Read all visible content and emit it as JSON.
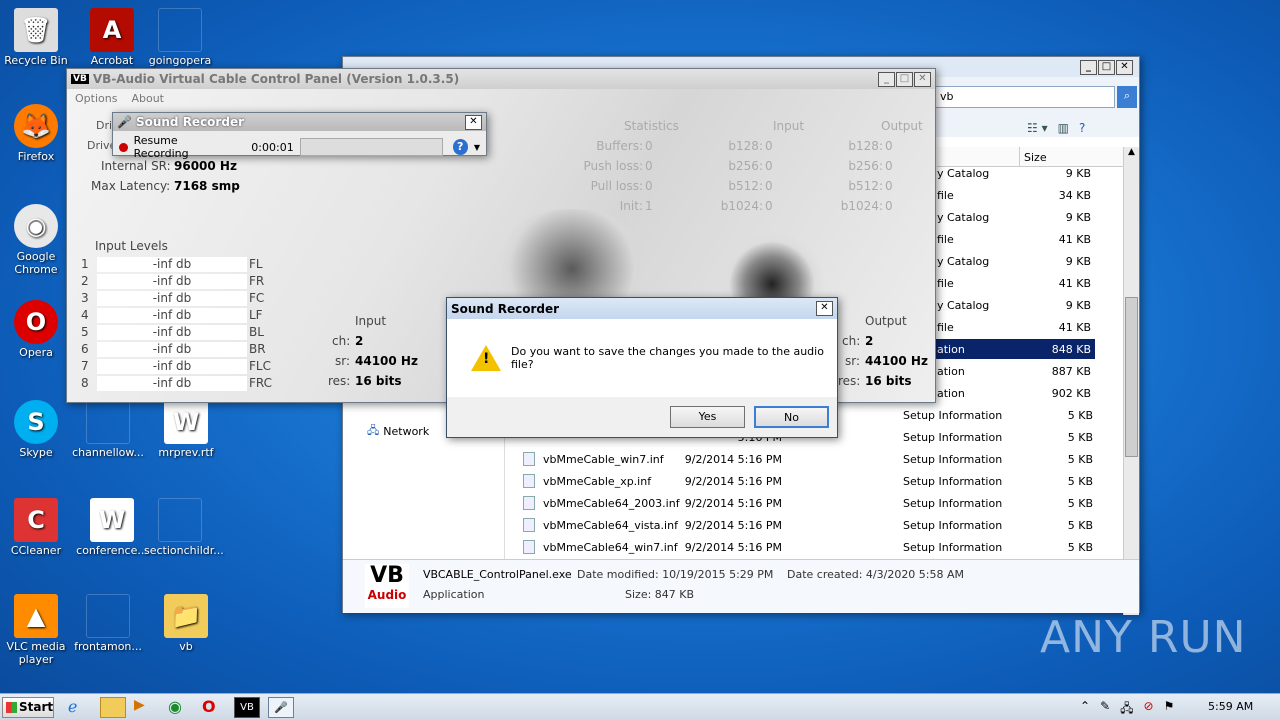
{
  "desktop": {
    "icons": [
      {
        "label": "Recycle Bin",
        "glyph": "🗑"
      },
      {
        "label": "Acrobat",
        "glyph": "A"
      },
      {
        "label": "goingopera",
        "glyph": ""
      },
      {
        "label": "Firefox",
        "glyph": "🦊"
      },
      {
        "label": "Google Chrome",
        "glyph": "◉"
      },
      {
        "label": "Opera",
        "glyph": "O"
      },
      {
        "label": "Skype",
        "glyph": "S"
      },
      {
        "label": "channellow...",
        "glyph": ""
      },
      {
        "label": "mrprev.rtf",
        "glyph": "W"
      },
      {
        "label": "CCleaner",
        "glyph": "C"
      },
      {
        "label": "conference...",
        "glyph": "W"
      },
      {
        "label": "sectionchildr...",
        "glyph": ""
      },
      {
        "label": "VLC media player",
        "glyph": "▲"
      },
      {
        "label": "frontamon...",
        "glyph": ""
      },
      {
        "label": "vb",
        "glyph": "📁"
      }
    ]
  },
  "vb_panel": {
    "title": "VB-Audio Virtual Cable Control Panel (Version 1.0.3.5)",
    "menu": [
      "Options",
      "About"
    ],
    "labels": {
      "internal_sr": "Internal SR:",
      "max_latency": "Max Latency:",
      "driver1": "Dri",
      "driver2": "Drive"
    },
    "values": {
      "internal_sr": "96000 Hz",
      "max_latency": "7168 smp"
    },
    "input_levels_title": "Input Levels",
    "levels": [
      {
        "n": "1",
        "val": "-inf db",
        "ch": "FL"
      },
      {
        "n": "2",
        "val": "-inf db",
        "ch": "FR"
      },
      {
        "n": "3",
        "val": "-inf db",
        "ch": "FC"
      },
      {
        "n": "4",
        "val": "-inf db",
        "ch": "LF"
      },
      {
        "n": "5",
        "val": "-inf db",
        "ch": "BL"
      },
      {
        "n": "6",
        "val": "-inf db",
        "ch": "BR"
      },
      {
        "n": "7",
        "val": "-inf db",
        "ch": "FLC"
      },
      {
        "n": "8",
        "val": "-inf db",
        "ch": "FRC"
      }
    ],
    "stats": {
      "headers": [
        "Statistics",
        "Input",
        "Output"
      ],
      "rows": [
        {
          "a": "Buffers:",
          "av": "0",
          "b": "b128:",
          "bv": "0",
          "c": "b128:",
          "cv": "0"
        },
        {
          "a": "Push loss:",
          "av": "0",
          "b": "b256:",
          "bv": "0",
          "c": "b256:",
          "cv": "0"
        },
        {
          "a": "Pull loss:",
          "av": "0",
          "b": "b512:",
          "bv": "0",
          "c": "b512:",
          "cv": "0"
        },
        {
          "a": "Init:",
          "av": "1",
          "b": "b1024:",
          "bv": "0",
          "c": "b1024:",
          "cv": "0"
        }
      ]
    },
    "input": {
      "title": "Input",
      "ch_label": "ch:",
      "ch": "2",
      "sr_label": "sr:",
      "sr": "44100 Hz",
      "res_label": "res:",
      "res": "16 bits"
    },
    "output": {
      "title": "Output",
      "ch_label": "ch:",
      "ch": "2",
      "sr_label": "sr:",
      "sr": "44100 Hz",
      "res_label": "res:",
      "res": "16 bits"
    }
  },
  "recorder": {
    "title": "Sound Recorder",
    "resume": "Resume Recording",
    "time": "0:00:01",
    "help": "?"
  },
  "dialog": {
    "title": "Sound Recorder",
    "message": "Do you want to save the changes you made to the audio file?",
    "yes": "Yes",
    "no": "No"
  },
  "explorer": {
    "search_value": "vb",
    "size_header": "Size",
    "network": "Network",
    "partial_rows": [
      {
        "type": "y Catalog",
        "size": "9 KB"
      },
      {
        "type": "file",
        "size": "34 KB"
      },
      {
        "type": "y Catalog",
        "size": "9 KB"
      },
      {
        "type": "file",
        "size": "41 KB"
      },
      {
        "type": "y Catalog",
        "size": "9 KB"
      },
      {
        "type": "file",
        "size": "41 KB"
      },
      {
        "type": "y Catalog",
        "size": "9 KB"
      },
      {
        "type": "file",
        "size": "41 KB"
      },
      {
        "type": "ation",
        "size": "848 KB"
      },
      {
        "type": "ation",
        "size": "887 KB"
      },
      {
        "type": "ation",
        "size": "902 KB"
      }
    ],
    "files": [
      {
        "name": "",
        "date": "5:16 PM",
        "type": "Setup Information",
        "size": "5 KB"
      },
      {
        "name": "",
        "date": "5:16 PM",
        "type": "Setup Information",
        "size": "5 KB"
      },
      {
        "name": "vbMmeCable_win7.inf",
        "date": "9/2/2014 5:16 PM",
        "type": "Setup Information",
        "size": "5 KB"
      },
      {
        "name": "vbMmeCable_xp.inf",
        "date": "9/2/2014 5:16 PM",
        "type": "Setup Information",
        "size": "5 KB"
      },
      {
        "name": "vbMmeCable64_2003.inf",
        "date": "9/2/2014 5:16 PM",
        "type": "Setup Information",
        "size": "5 KB"
      },
      {
        "name": "vbMmeCable64_vista.inf",
        "date": "9/2/2014 5:16 PM",
        "type": "Setup Information",
        "size": "5 KB"
      },
      {
        "name": "vbMmeCable64_win7.inf",
        "date": "9/2/2014 5:16 PM",
        "type": "Setup Information",
        "size": "5 KB"
      }
    ],
    "details": {
      "filename": "VBCABLE_ControlPanel.exe",
      "modified_label": "Date modified:",
      "modified": "10/19/2015 5:29 PM",
      "created_label": "Date created:",
      "created": "4/3/2020 5:58 AM",
      "kind": "Application",
      "size_label": "Size:",
      "size": "847 KB"
    }
  },
  "taskbar": {
    "start": "Start",
    "clock": "5:59 AM"
  },
  "watermark": "ANY RUN"
}
